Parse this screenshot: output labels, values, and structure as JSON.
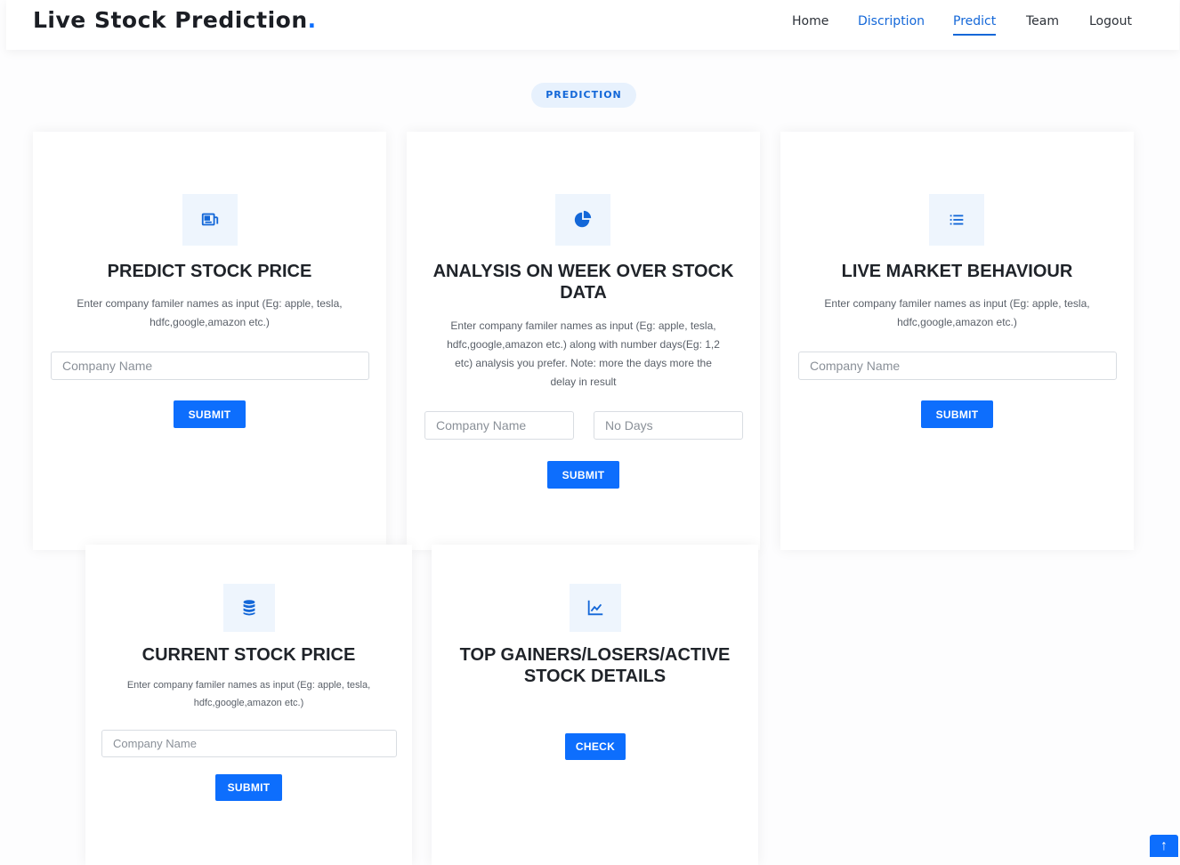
{
  "header": {
    "brand": "Live Stock Prediction",
    "brand_dot": ".",
    "nav": [
      {
        "label": "Home"
      },
      {
        "label": "Discription"
      },
      {
        "label": "Predict"
      },
      {
        "label": "Team"
      },
      {
        "label": "Logout"
      }
    ]
  },
  "section": {
    "pill": "PREDICTION"
  },
  "cards": {
    "predict": {
      "icon": "newspaper-icon",
      "title": "PREDICT STOCK PRICE",
      "desc_line1": "Enter company familer names as input (Eg: apple, tesla,",
      "desc_line2": "hdfc,google,amazon etc.)",
      "input_placeholder": "Company Name",
      "button": "SUBMIT"
    },
    "analysis": {
      "icon": "pie-chart-icon",
      "title_line1": "ANALYSIS ON WEEK OVER STOCK",
      "title_line2": "DATA",
      "desc_line1": "Enter company familer names as input (Eg: apple, tesla,",
      "desc_line2": "hdfc,google,amazon etc.) along with number days(Eg: 1,2",
      "desc_line3": "etc) analysis you prefer. Note: more the days more the",
      "desc_line4": "delay in result",
      "company_placeholder": "Company Name",
      "days_placeholder": "No Days",
      "button": "SUBMIT"
    },
    "live": {
      "icon": "list-icon",
      "title": "LIVE MARKET BEHAVIOUR",
      "desc_line1": "Enter company familer names as input (Eg: apple, tesla,",
      "desc_line2": "hdfc,google,amazon etc.)",
      "input_placeholder": "Company Name",
      "button": "SUBMIT"
    },
    "current": {
      "icon": "database-icon",
      "title": "CURRENT STOCK PRICE",
      "desc_line1": "Enter company familer names as input (Eg: apple, tesla,",
      "desc_line2": "hdfc,google,amazon etc.)",
      "input_placeholder": "Company Name",
      "button": "SUBMIT"
    },
    "top": {
      "icon": "line-chart-icon",
      "title_line1": "TOP GAINERS/LOSERS/ACTIVE",
      "title_line2": "STOCK DETAILS",
      "button": "CHECK"
    }
  },
  "scroll_top": {
    "icon": "arrow-up-icon",
    "glyph": "↑"
  },
  "colors": {
    "accent": "#0d6efd",
    "icon_bg": "#eef5fd",
    "pill_bg": "#e7f1fd"
  }
}
